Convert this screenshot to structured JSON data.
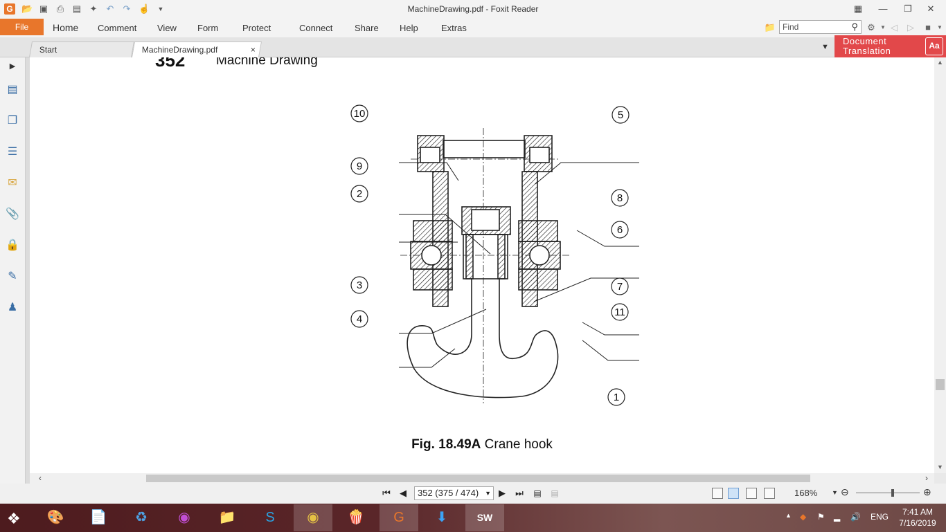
{
  "window": {
    "title": "MachineDrawing.pdf - Foxit Reader"
  },
  "menu": {
    "file": "File",
    "items": [
      "Home",
      "Comment",
      "View",
      "Form",
      "Protect",
      "Connect",
      "Share",
      "Help",
      "Extras"
    ],
    "find_placeholder": "Find"
  },
  "tabs": [
    {
      "label": "Start"
    },
    {
      "label": "MachineDrawing.pdf",
      "close": "×"
    }
  ],
  "doc_translation": {
    "line1": "Document",
    "line2": "Translation",
    "icon_text": "Aa"
  },
  "page": {
    "number": "352",
    "header": "Machine Drawing",
    "caption_bold": "Fig. 18.49A",
    "caption_text": " Crane hook",
    "callouts": [
      "10",
      "5",
      "9",
      "2",
      "8",
      "6",
      "3",
      "7",
      "4",
      "11",
      "1"
    ]
  },
  "status": {
    "page_indicator": "352 (375 / 474)",
    "zoom": "168%"
  },
  "taskbar": {
    "language": "ENG",
    "time": "7:41 AM",
    "date": "7/16/2019"
  },
  "colors": {
    "accent": "#e8762b",
    "translate_red": "#e2484a"
  },
  "icons": [
    "app-logo-icon",
    "open-icon",
    "save-icon",
    "print-icon",
    "properties-icon",
    "new-icon",
    "undo-icon",
    "redo-icon",
    "hand-icon",
    "find-icon",
    "settings-icon"
  ]
}
